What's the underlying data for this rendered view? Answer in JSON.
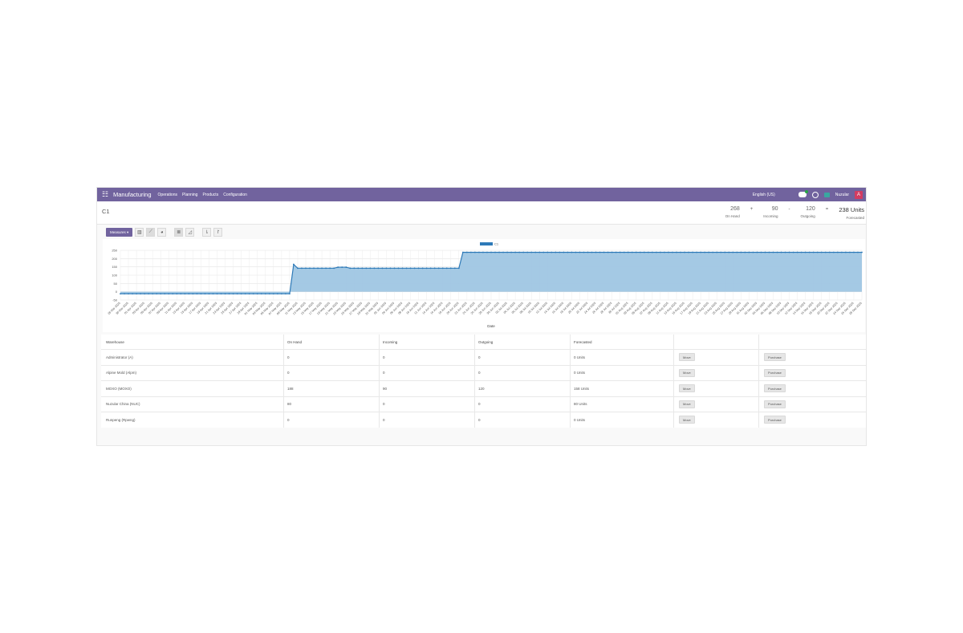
{
  "navbar": {
    "app_name": "Manufacturing",
    "menus": [
      "Operations",
      "Planning",
      "Products",
      "Configuration"
    ],
    "language": "English (US)",
    "company": "Nuzular",
    "avatar_letter": "A",
    "color": "#71639e"
  },
  "page": {
    "title": "C1",
    "stats": [
      {
        "value": "268",
        "label": "On Hand"
      },
      {
        "op": "+",
        "value": "90",
        "label": "Incoming"
      },
      {
        "op": "-",
        "value": "120",
        "label": "Outgoing"
      },
      {
        "op": "=",
        "value": "238 Units",
        "label": "Forecasted"
      }
    ]
  },
  "toolbar": {
    "measures_label": "Measures ▾",
    "icons": [
      "bar-chart-icon",
      "line-chart-icon",
      "pie-chart-icon",
      "stacked-icon",
      "cumulative-icon",
      "sort-desc-icon",
      "sort-asc-icon"
    ]
  },
  "chart_data": {
    "type": "area",
    "legend": [
      "C1"
    ],
    "legend_placement": "top-center",
    "xlabel": "Date",
    "ylabel": "",
    "yticks": [
      250,
      200,
      150,
      100,
      50,
      0,
      -50
    ],
    "ylim": [
      -50,
      250
    ],
    "grid": true,
    "color": "#2e7ab8",
    "fill": "#9fc6e3",
    "x": [
      "28 Mar 2025",
      "29 Mar 2025",
      "30 Mar 2025",
      "31 Mar 2025",
      "01 Apr 2025",
      "02 Apr 2025",
      "03 Apr 2025",
      "04 Apr 2025",
      "05 Apr 2025",
      "06 Apr 2025",
      "07 Apr 2025",
      "08 Apr 2025",
      "09 Apr 2025",
      "10 Apr 2025",
      "11 Apr 2025",
      "12 Apr 2025",
      "13 Apr 2025",
      "14 Apr 2025",
      "15 Apr 2025",
      "16 Apr 2025",
      "17 Apr 2025",
      "18 Apr 2025",
      "19 Apr 2025",
      "20 Apr 2025",
      "21 Apr 2025",
      "22 Apr 2025",
      "23 Apr 2025",
      "24 Apr 2025",
      "25 Apr 2025",
      "26 Apr 2025",
      "27 Apr 2025",
      "28 Apr 2025",
      "29 Apr 2025",
      "30 Apr 2025",
      "01 May 2025",
      "02 May 2025",
      "03 May 2025",
      "04 May 2025",
      "05 May 2025",
      "06 May 2025",
      "07 May 2025",
      "08 May 2025",
      "09 May 2025",
      "10 May 2025",
      "11 May 2025",
      "12 May 2025",
      "13 May 2025",
      "14 May 2025",
      "15 May 2025",
      "16 May 2025",
      "17 May 2025",
      "18 May 2025",
      "19 May 2025",
      "20 May 2025",
      "21 May 2025",
      "22 May 2025",
      "23 May 2025",
      "24 May 2025",
      "25 May 2025",
      "26 May 2025",
      "27 May 2025",
      "28 May 2025",
      "29 May 2025",
      "30 May 2025",
      "31 May 2025",
      "01 Jun 2025",
      "02 Jun 2025",
      "03 Jun 2025",
      "04 Jun 2025",
      "05 Jun 2025",
      "06 Jun 2025",
      "07 Jun 2025",
      "08 Jun 2025",
      "09 Jun 2025",
      "10 Jun 2025",
      "11 Jun 2025",
      "12 Jun 2025",
      "13 Jun 2025",
      "14 Jun 2025",
      "15 Jun 2025",
      "16 Jun 2025",
      "17 Jun 2025",
      "18 Jun 2025",
      "19 Jun 2025",
      "20 Jun 2025",
      "21 Jun 2025",
      "22 Jun 2025",
      "23 Jun 2025",
      "24 Jun 2025",
      "25 Jun 2025",
      "26 Jun 2025",
      "27 Jun 2025",
      "28 Jun 2025",
      "29 Jun 2025",
      "30 Jun 2025",
      "01 Jul 2025",
      "02 Jul 2025",
      "03 Jul 2025",
      "04 Jul 2025",
      "05 Jul 2025",
      "06 Jul 2025",
      "07 Jul 2025",
      "08 Jul 2025",
      "09 Jul 2025",
      "10 Jul 2025",
      "11 Jul 2025",
      "12 Jul 2025",
      "13 Jul 2025",
      "14 Jul 2025",
      "15 Jul 2025",
      "16 Jul 2025",
      "17 Jul 2025",
      "18 Jul 2025",
      "19 Jul 2025",
      "20 Jul 2025",
      "21 Jul 2025",
      "22 Jul 2025",
      "23 Jul 2025",
      "24 Jul 2025",
      "25 Jul 2025",
      "26 Jul 2025",
      "27 Jul 2025",
      "28 Jul 2025",
      "29 Jul 2025",
      "30 Jul 2025",
      "31 Jul 2025",
      "01 Aug 2025",
      "02 Aug 2025",
      "03 Aug 2025",
      "04 Aug 2025",
      "05 Aug 2025",
      "06 Aug 2025",
      "07 Aug 2025",
      "08 Aug 2025",
      "09 Aug 2025",
      "10 Aug 2025",
      "11 Aug 2025",
      "12 Aug 2025",
      "13 Aug 2025",
      "14 Aug 2025",
      "15 Aug 2025",
      "16 Aug 2025",
      "17 Aug 2025",
      "18 Aug 2025",
      "19 Aug 2025",
      "20 Aug 2025",
      "21 Aug 2025",
      "22 Aug 2025",
      "23 Aug 2025",
      "24 Aug 2025",
      "25 Aug 2025",
      "26 Aug 2025",
      "27 Aug 2025",
      "28 Aug 2025",
      "29 Aug 2025",
      "30 Aug 2025",
      "31 Aug 2025",
      "01 Sep 2025",
      "02 Sep 2025",
      "03 Sep 2025",
      "04 Sep 2025",
      "05 Sep 2025",
      "06 Sep 2025",
      "07 Sep 2025",
      "08 Sep 2025",
      "09 Sep 2025",
      "10 Sep 2025",
      "11 Sep 2025",
      "12 Sep 2025",
      "13 Sep 2025",
      "14 Sep 2025",
      "15 Sep 2025",
      "16 Sep 2025",
      "17 Sep 2025",
      "18 Sep 2025",
      "19 Sep 2025",
      "20 Sep 2025",
      "21 Sep 2025",
      "22 Sep 2025",
      "23 Sep 2025",
      "24 Sep 2025",
      "25 Sep 2025",
      "26 Sep 2025",
      "27 Sep 2025",
      "28 Sep 2025"
    ],
    "series": [
      {
        "name": "C1",
        "segments": [
          {
            "from": "28 Mar 2025",
            "to": "09 May 2025",
            "value": -12
          },
          {
            "from": "10 May 2025",
            "to": "10 May 2025",
            "value": 165
          },
          {
            "from": "11 May 2025",
            "to": "20 May 2025",
            "value": 142
          },
          {
            "from": "21 May 2025",
            "to": "23 May 2025",
            "value": 148
          },
          {
            "from": "24 May 2025",
            "to": "20 Jun 2025",
            "value": 142
          },
          {
            "from": "21 Jun 2025",
            "to": "28 Sep 2025",
            "value": 238
          }
        ]
      }
    ]
  },
  "table": {
    "headers": [
      "Warehouse",
      "On Hand",
      "Incoming",
      "Outgoing",
      "Forecasted",
      "",
      ""
    ],
    "rows": [
      {
        "warehouse": "Administrator (A)",
        "on_hand": "0",
        "incoming": "0",
        "outgoing": "0",
        "forecasted": "0 Units",
        "move": "Move",
        "purchase": "Purchase"
      },
      {
        "warehouse": "Alpine Mold (Alpm)",
        "on_hand": "0",
        "incoming": "0",
        "outgoing": "0",
        "forecasted": "0 Units",
        "move": "Move",
        "purchase": "Purchase"
      },
      {
        "warehouse": "MOXO (MOXO)",
        "on_hand": "188",
        "incoming": "90",
        "outgoing": "120",
        "forecasted": "158 Units",
        "move": "Move",
        "purchase": "Purchase"
      },
      {
        "warehouse": "Nuzular China (NUC)",
        "on_hand": "80",
        "incoming": "0",
        "outgoing": "0",
        "forecasted": "80 Units",
        "move": "Move",
        "purchase": "Purchase"
      },
      {
        "warehouse": "Runpeng (Rpwng)",
        "on_hand": "0",
        "incoming": "0",
        "outgoing": "0",
        "forecasted": "0 Units",
        "move": "Move",
        "purchase": "Purchase"
      }
    ]
  }
}
